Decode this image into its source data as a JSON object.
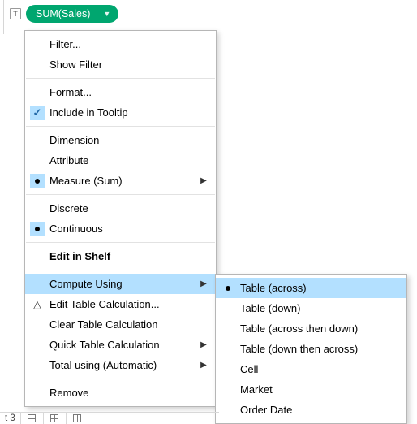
{
  "header": {
    "t_badge": "T",
    "pill_label": "SUM(Sales)"
  },
  "menu": {
    "filter": "Filter...",
    "show_filter": "Show Filter",
    "format": "Format...",
    "include_tooltip": "Include in Tooltip",
    "dimension": "Dimension",
    "attribute": "Attribute",
    "measure": "Measure (Sum)",
    "discrete": "Discrete",
    "continuous": "Continuous",
    "edit_in_shelf": "Edit in Shelf",
    "compute_using": "Compute Using",
    "edit_table_calc": "Edit Table Calculation...",
    "clear_table_calc": "Clear Table Calculation",
    "quick_table_calc": "Quick Table Calculation",
    "total_using": "Total using (Automatic)",
    "remove": "Remove"
  },
  "submenu": {
    "table_across": "Table (across)",
    "table_down": "Table (down)",
    "table_across_down": "Table (across then down)",
    "table_down_across": "Table (down then across)",
    "cell": "Cell",
    "market": "Market",
    "order_date": "Order Date"
  },
  "bottom": {
    "sheet": "t 3"
  }
}
